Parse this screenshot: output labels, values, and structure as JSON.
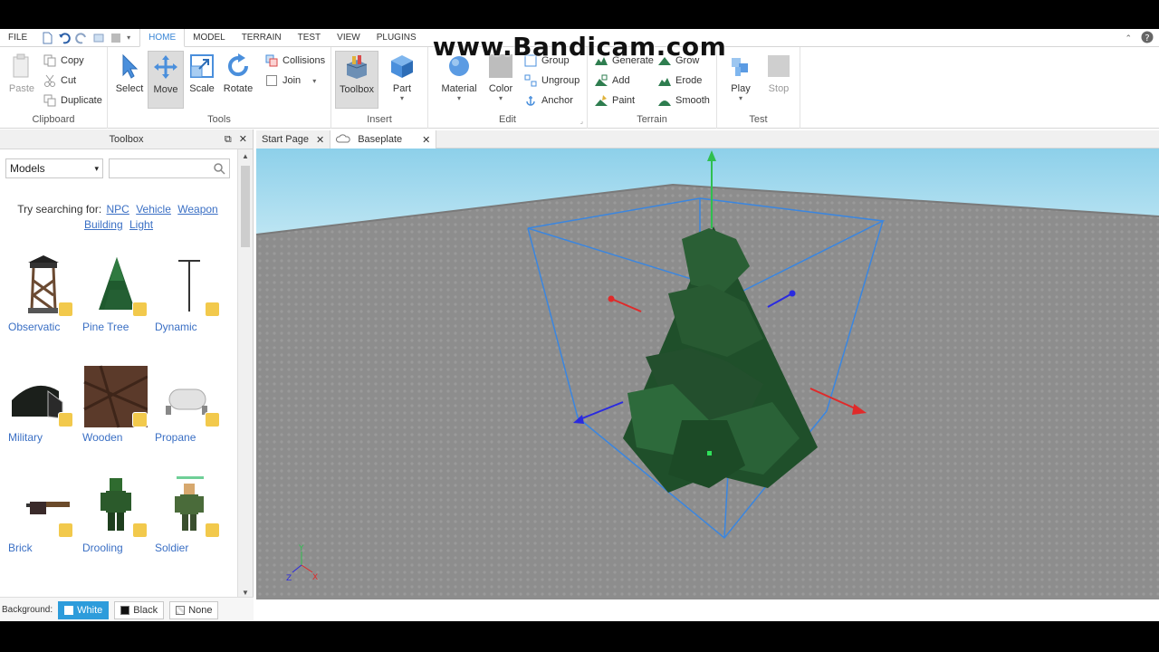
{
  "watermark": "www.Bandicam.com",
  "menubar": {
    "file": "FILE",
    "tabs": [
      "HOME",
      "MODEL",
      "TERRAIN",
      "TEST",
      "VIEW",
      "PLUGINS"
    ],
    "active_tab": "HOME"
  },
  "ribbon": {
    "clipboard": {
      "label": "Clipboard",
      "paste": "Paste",
      "copy": "Copy",
      "cut": "Cut",
      "duplicate": "Duplicate"
    },
    "tools": {
      "label": "Tools",
      "select": "Select",
      "move": "Move",
      "scale": "Scale",
      "rotate": "Rotate",
      "collisions": "Collisions",
      "join": "Join"
    },
    "insert": {
      "label": "Insert",
      "toolbox": "Toolbox",
      "part": "Part"
    },
    "edit": {
      "label": "Edit",
      "material": "Material",
      "color": "Color",
      "group": "Group",
      "ungroup": "Ungroup",
      "anchor": "Anchor"
    },
    "terrain": {
      "label": "Terrain",
      "generate": "Generate",
      "grow": "Grow",
      "add": "Add",
      "erode": "Erode",
      "paint": "Paint",
      "smooth": "Smooth"
    },
    "test": {
      "label": "Test",
      "play": "Play",
      "stop": "Stop"
    }
  },
  "toolbox": {
    "title": "Toolbox",
    "category": "Models",
    "search_placeholder": "",
    "suggest_prefix": "Try searching for:",
    "suggestions": [
      "NPC",
      "Vehicle",
      "Weapon",
      "Building",
      "Light"
    ],
    "items": [
      "Observatic",
      "Pine Tree",
      "Dynamic",
      "Military",
      "Wooden",
      "Propane",
      "Brick",
      "Drooling",
      "Soldier"
    ],
    "background_label": "Background:",
    "background_options": [
      "White",
      "Black",
      "None"
    ]
  },
  "doc_tabs": [
    "Start Page",
    "Baseplate"
  ],
  "colors": {
    "accent": "#3a86d6",
    "link": "#3a6fc4",
    "selection_box": "#3aa0ff",
    "sky": "#a7dbee",
    "ground": "#8c8c8c"
  }
}
